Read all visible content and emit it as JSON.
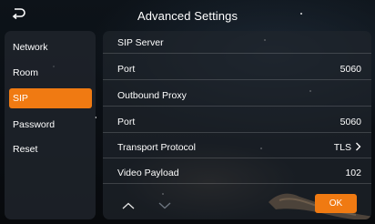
{
  "header": {
    "title": "Advanced Settings",
    "back_icon": "back-arrow-icon"
  },
  "sidebar": {
    "items": [
      {
        "label": "Network",
        "active": false
      },
      {
        "label": "Room",
        "active": false
      },
      {
        "label": "SIP",
        "active": true
      },
      {
        "label": "Password",
        "active": false
      },
      {
        "label": "Reset",
        "active": false
      }
    ]
  },
  "panel": {
    "rows": [
      {
        "label": "SIP Server",
        "value": ""
      },
      {
        "label": "Port",
        "value": "5060"
      },
      {
        "label": "Outbound Proxy",
        "value": ""
      },
      {
        "label": "Port",
        "value": "5060"
      },
      {
        "label": "Transport Protocol",
        "value": "TLS"
      },
      {
        "label": "Video Payload",
        "value": "102"
      }
    ],
    "ok_label": "OK"
  },
  "colors": {
    "accent": "#f07a12",
    "panel": "#20252c",
    "background": "#0a0e13"
  }
}
